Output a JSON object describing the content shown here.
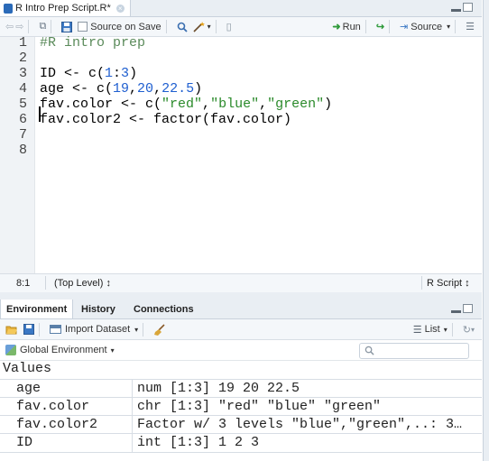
{
  "editor": {
    "tab_title": "R Intro Prep Script.R*",
    "toolbar": {
      "source_on_save": "Source on Save",
      "run": "Run",
      "source": "Source"
    },
    "lines": [
      {
        "num": "1",
        "text": "#R intro prep"
      },
      {
        "num": "2",
        "text": ""
      },
      {
        "num": "3",
        "text": "ID <- c(1:3)"
      },
      {
        "num": "4",
        "text": "age <- c(19,20,22.5)"
      },
      {
        "num": "5",
        "text": "fav.color <- c(\"red\",\"blue\",\"green\")"
      },
      {
        "num": "6",
        "text": "fav.color2 <- factor(fav.color)"
      },
      {
        "num": "7",
        "text": ""
      },
      {
        "num": "8",
        "text": ""
      }
    ],
    "status": {
      "position": "8:1",
      "scope": "(Top Level) ↕",
      "filetype": "R Script ↕"
    }
  },
  "env_pane": {
    "tabs": [
      "Environment",
      "History",
      "Connections"
    ],
    "toolbar": {
      "import_dataset": "Import Dataset",
      "list": "List"
    },
    "scope": "Global Environment",
    "values_header": "Values",
    "rows": [
      {
        "name": "age",
        "value": "num [1:3] 19 20 22.5"
      },
      {
        "name": "fav.color",
        "value": "chr [1:3] \"red\" \"blue\" \"green\""
      },
      {
        "name": "fav.color2",
        "value": "Factor w/ 3 levels \"blue\",\"green\",..: 3…"
      },
      {
        "name": "ID",
        "value": "int [1:3] 1 2 3"
      }
    ]
  },
  "colors": {
    "pane_bg": "#e9eef3",
    "toolbar_bg": "#f4f7fa",
    "accent_green": "#2e9a3a",
    "accent_blue": "#1f5fd0"
  }
}
